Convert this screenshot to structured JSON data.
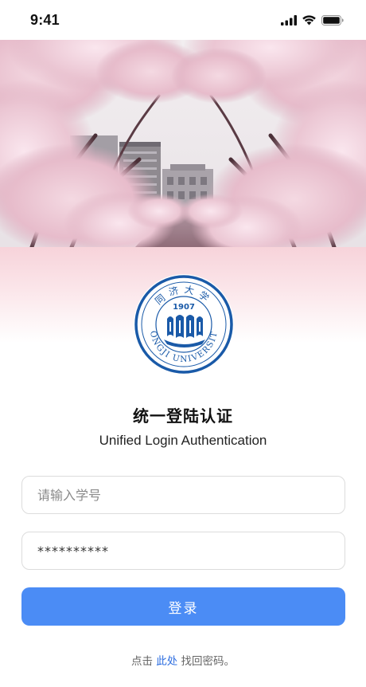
{
  "status_bar": {
    "time": "9:41",
    "signal_icon": "cellular-signal-icon",
    "wifi_icon": "wifi-icon",
    "battery_icon": "battery-icon"
  },
  "hero": {
    "image": "cherry-blossom-campus-photo"
  },
  "emblem": {
    "name": "tongji-university-emblem",
    "year": "1907",
    "ring_text": "TONGJI UNIVERSITY",
    "top_text": "同济大学"
  },
  "title": "统一登陆认证",
  "subtitle": "Unified Login Authentication",
  "form": {
    "student_id_placeholder": "请输入学号",
    "student_id_value": "",
    "password_value": "**********",
    "login_label": "登录"
  },
  "footer": {
    "prefix": "点击",
    "link": "此处",
    "suffix": "找回密码。"
  },
  "colors": {
    "primary": "#4b8cf5",
    "link": "#2f6fe0",
    "emblem_blue": "#1a5aa8",
    "pink": "#f7d3da"
  }
}
